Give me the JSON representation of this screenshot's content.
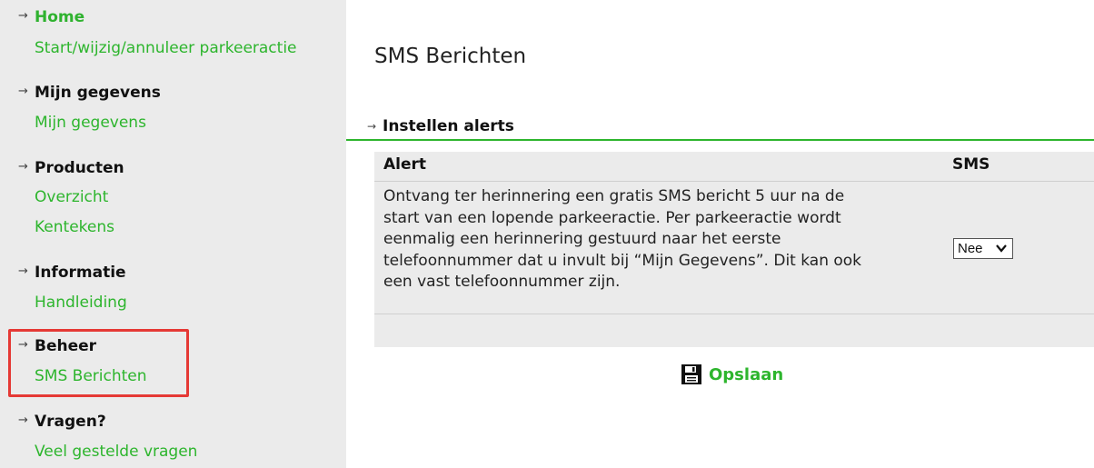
{
  "sidebar": {
    "groups": [
      {
        "heading": "Home",
        "links": [
          "Start/wijzig/annuleer parkeeractie"
        ]
      },
      {
        "heading": "Mijn gegevens",
        "links": [
          "Mijn gegevens"
        ]
      },
      {
        "heading": "Producten",
        "links": [
          "Overzicht",
          "Kentekens"
        ]
      },
      {
        "heading": "Informatie",
        "links": [
          "Handleiding"
        ]
      },
      {
        "heading": "Beheer",
        "links": [
          "SMS Berichten"
        ]
      },
      {
        "heading": "Vragen?",
        "links": [
          "Veel gestelde vragen"
        ]
      }
    ]
  },
  "main": {
    "title": "SMS Berichten",
    "section_title": "Instellen alerts",
    "table": {
      "headers": {
        "alert": "Alert",
        "sms": "SMS"
      },
      "rows": [
        {
          "text_lines": [
            "Ontvang ter herinnering een gratis SMS bericht 5 uur na de",
            "start van een lopende parkeeractie. Per parkeeractie wordt",
            "eenmalig een herinnering gestuurd naar het eerste",
            "telefoonnummer dat u invult bij “Mijn Gegevens”. Dit kan ook",
            "een vast telefoonnummer zijn."
          ],
          "sms_value": "Nee"
        }
      ]
    },
    "save_label": "Opslaan"
  },
  "colors": {
    "accent_green": "#2db52d",
    "sidebar_bg": "#ebebeb",
    "highlight_red": "#e53935"
  },
  "icons": {
    "nav_arrow": "arrow-right-icon",
    "save": "floppy-disk-icon",
    "select": "chevron-down-icon"
  }
}
